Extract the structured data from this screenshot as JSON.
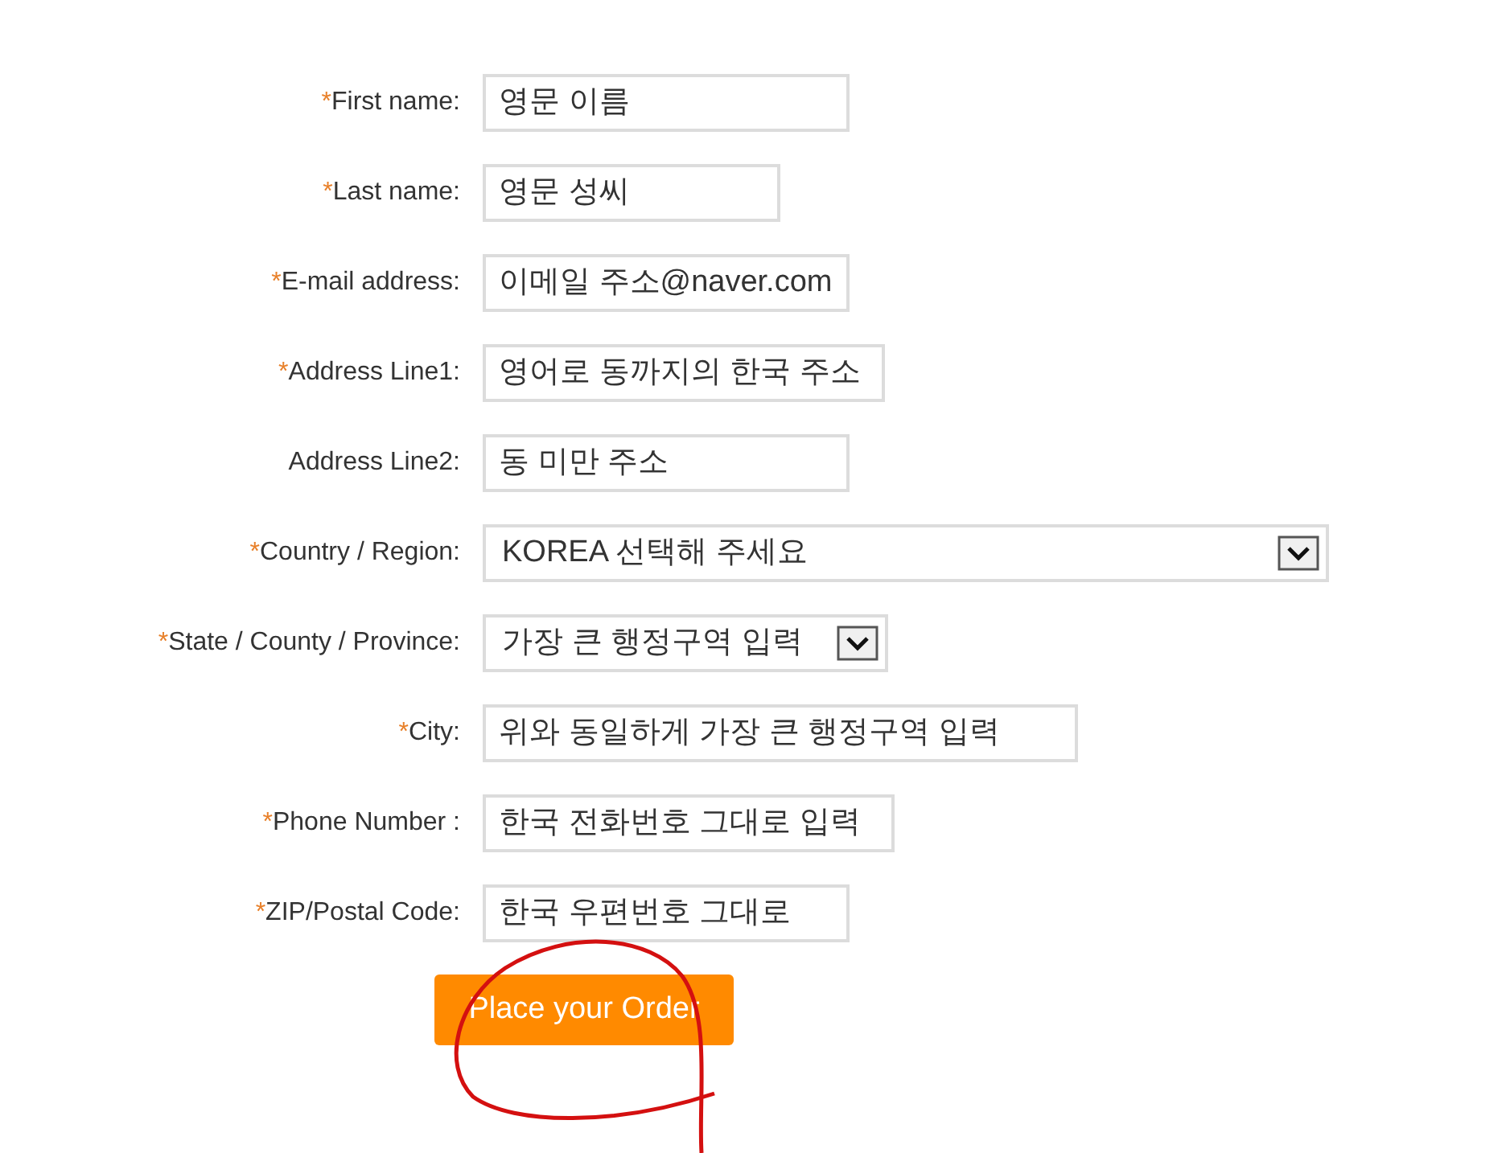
{
  "fields": [
    {
      "label": "First name:",
      "required_mark": "*",
      "kind": "text",
      "value": "영문 이름"
    },
    {
      "label": "Last name:",
      "required_mark": "*",
      "kind": "text",
      "value": "영문 성씨"
    },
    {
      "label": "E-mail address:",
      "required_mark": "*",
      "kind": "text",
      "value": "이메일 주소@naver.com"
    },
    {
      "label": "Address Line1:",
      "required_mark": "*",
      "kind": "text",
      "value": "영어로 동까지의 한국 주소"
    },
    {
      "label": "Address Line2:",
      "kind": "text",
      "value": "동 미만 주소"
    },
    {
      "label": "Country / Region:",
      "required_mark": "*",
      "kind": "select",
      "value": "KOREA 선택해 주세요"
    },
    {
      "label": "State / County / Province:",
      "required_mark": "*",
      "kind": "select",
      "value": "가장 큰 행정구역  입력"
    },
    {
      "label": "City:",
      "required_mark": "*",
      "kind": "text",
      "value": "위와 동일하게 가장 큰 행정구역 입력"
    },
    {
      "label": "Phone Number :",
      "required_mark": "*",
      "kind": "text",
      "value": "한국 전화번호 그대로 입력"
    },
    {
      "label": "ZIP/Postal Code:",
      "required_mark": "*",
      "kind": "text",
      "value": "한국 우편번호 그대로"
    }
  ],
  "submit": {
    "label": "Place your Order"
  }
}
